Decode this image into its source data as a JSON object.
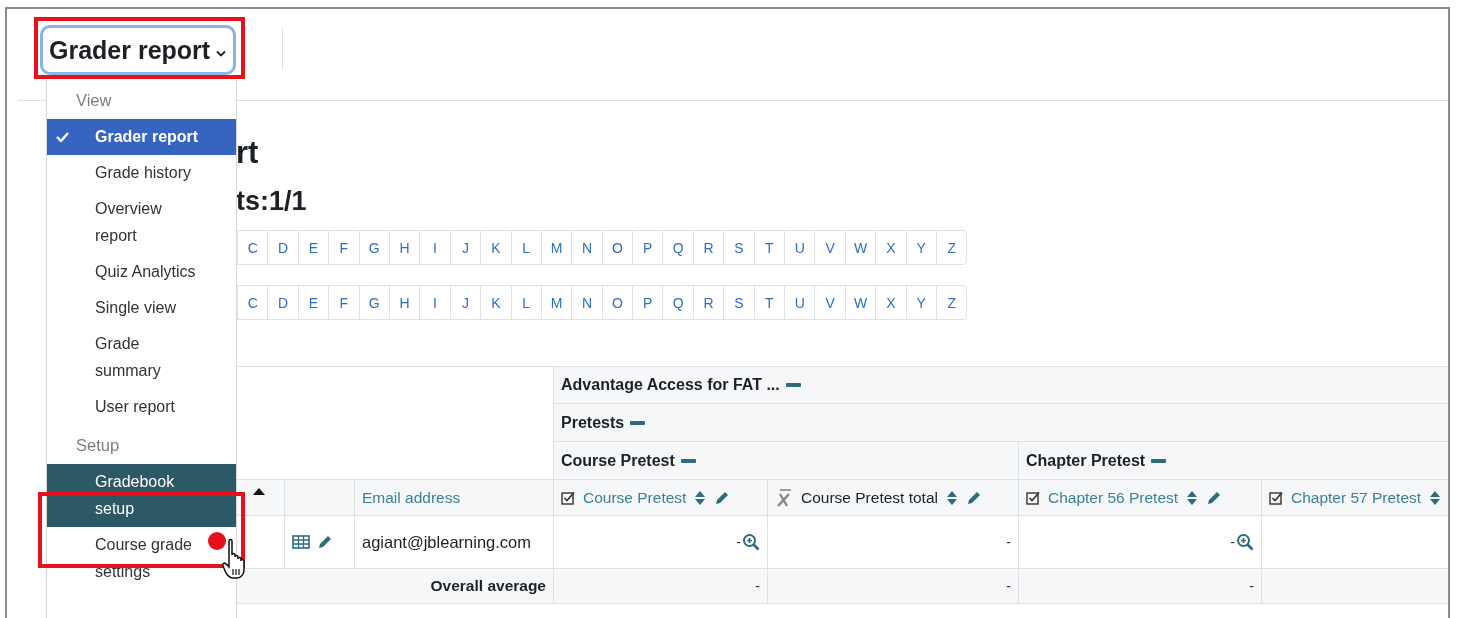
{
  "page_header": {
    "report_selector": {
      "label": "Grader report"
    }
  },
  "report_menu": {
    "groups": [
      {
        "heading": "View",
        "items": [
          {
            "label": "Grader report",
            "selected": true,
            "highlighted": false
          },
          {
            "label": "Grade history",
            "selected": false,
            "highlighted": false
          },
          {
            "label": "Overview report",
            "selected": false,
            "highlighted": false
          },
          {
            "label": "Quiz Analytics",
            "selected": false,
            "highlighted": false
          },
          {
            "label": "Single view",
            "selected": false,
            "highlighted": false
          },
          {
            "label": "Grade summary",
            "selected": false,
            "highlighted": false
          },
          {
            "label": "User report",
            "selected": false,
            "highlighted": false
          }
        ]
      },
      {
        "heading": "Setup",
        "items": [
          {
            "label": "Gradebook setup",
            "selected": false,
            "highlighted": true
          },
          {
            "label": "Course grade settings",
            "selected": false,
            "highlighted": false
          }
        ]
      }
    ]
  },
  "page_title": "rt",
  "subtitle": "ts:1/1",
  "letter_bars": [
    {
      "letters": [
        "C",
        "D",
        "E",
        "F",
        "G",
        "H",
        "I",
        "J",
        "K",
        "L",
        "M",
        "N",
        "O",
        "P",
        "Q",
        "R",
        "S",
        "T",
        "U",
        "V",
        "W",
        "X",
        "Y",
        "Z"
      ]
    },
    {
      "letters": [
        "C",
        "D",
        "E",
        "F",
        "G",
        "H",
        "I",
        "J",
        "K",
        "L",
        "M",
        "N",
        "O",
        "P",
        "Q",
        "R",
        "S",
        "T",
        "U",
        "V",
        "W",
        "X",
        "Y",
        "Z"
      ]
    }
  ],
  "grade_table": {
    "category_rows": [
      [
        {
          "label": "Advantage Access for FAT ..."
        }
      ],
      [
        {
          "label": "Pretests"
        }
      ],
      [
        {
          "label": "Course Pretest"
        },
        {
          "label": "Chapter Pretest"
        }
      ]
    ],
    "columns": [
      {
        "kind": "sort"
      },
      {
        "kind": "blank"
      },
      {
        "kind": "user-field",
        "label": "Email address"
      },
      {
        "kind": "grade-item",
        "label": "Course Pretest",
        "edit_icon": true
      },
      {
        "kind": "course-total",
        "label": "Course Pretest total",
        "edit_icon": true
      },
      {
        "kind": "grade-item",
        "label": "Chapter 56 Pretest",
        "edit_icon": true
      },
      {
        "kind": "grade-item",
        "label": "Chapter 57 Pretest",
        "edit_icon": false
      }
    ],
    "rows": [
      [
        {
          "kind": "empty"
        },
        {
          "kind": "actions"
        },
        {
          "kind": "text",
          "text": "agiant@jblearning.com"
        },
        {
          "kind": "grade",
          "text": "-",
          "zoom": true
        },
        {
          "kind": "grade",
          "text": "-",
          "zoom": false
        },
        {
          "kind": "grade",
          "text": "-",
          "zoom": true
        },
        {
          "kind": "empty"
        }
      ]
    ],
    "average_row": {
      "label": "Overall average",
      "values": [
        "-",
        "-",
        "-"
      ]
    }
  }
}
